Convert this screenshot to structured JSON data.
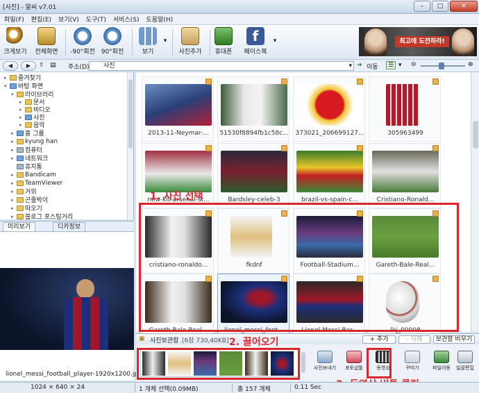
{
  "window": {
    "title": "[사진] - 알씨 v7.01"
  },
  "menu": [
    "파일(F)",
    "편집(E)",
    "보기(V)",
    "도구(T)",
    "서비스(S)",
    "도움말(H)"
  ],
  "toolbar": {
    "buttons": [
      "크게보기",
      "전체화면",
      "-90°회전",
      "90°회전",
      "보기",
      "사진추가",
      "휴대폰",
      "페이스북"
    ]
  },
  "banner": {
    "text": "최고에 도전하라!"
  },
  "address": {
    "label": "주소(D)",
    "value": "사진",
    "go": "이동"
  },
  "tree": {
    "items": [
      "즐겨찾기",
      "바탕 화면",
      "라이브러리",
      "문서",
      "비디오",
      "사진",
      "음악",
      "홈 그룹",
      "kyung han",
      "컴퓨터",
      "네트워크",
      "휴지통",
      "Bandicam",
      "TeamViewer",
      "거위",
      "곤줄박이",
      "따오기",
      "블로그 포스팅거리"
    ]
  },
  "preview": {
    "tabs": [
      "미리보기",
      "디카정보"
    ],
    "filename": "lionel_messi_football_player-1920x1200.jpg"
  },
  "thumbnails": [
    {
      "label": "2013-11-Neymar-..."
    },
    {
      "label": "51530f8894fb1c58c..."
    },
    {
      "label": "373021_206699127..."
    },
    {
      "label": "305963499"
    },
    {
      "label": "new-kit-arsenal-st..."
    },
    {
      "label": "Bardsley-celeb-3"
    },
    {
      "label": "brazil-vs-spain-c..."
    },
    {
      "label": "Cristiano-Ronald..."
    },
    {
      "label": "cristiano-ronaldo..."
    },
    {
      "label": "fkdnf"
    },
    {
      "label": "Football-Stadium..."
    },
    {
      "label": "Gareth-Bale-Real..."
    },
    {
      "label": "Gareth-Bale-Real..."
    },
    {
      "label": "lionel_messi_foot..."
    },
    {
      "label": "Lionel-Messi-Bar..."
    },
    {
      "label": "lkj_00008"
    }
  ],
  "annotations": {
    "step1": "1. 사진 선택",
    "step2": "2. 끌어오기",
    "step3": "3. 동영상 버튼 클릭"
  },
  "storage": {
    "title": "사진보관함",
    "info": "[6장 730,40KB]",
    "add": "+ 추가",
    "remove": "- 삭제",
    "clear": "보관함 비우기",
    "actions": [
      "사진보내기",
      "포토샵툴",
      "동영상",
      "꾸미기",
      "파일이동",
      "일괄편집"
    ]
  },
  "status": {
    "dims": "1024 × 640 × 24",
    "selected": "1 개체 선택(0.09MB)",
    "total": "총 157 개체",
    "time": "0.11 Sec"
  }
}
